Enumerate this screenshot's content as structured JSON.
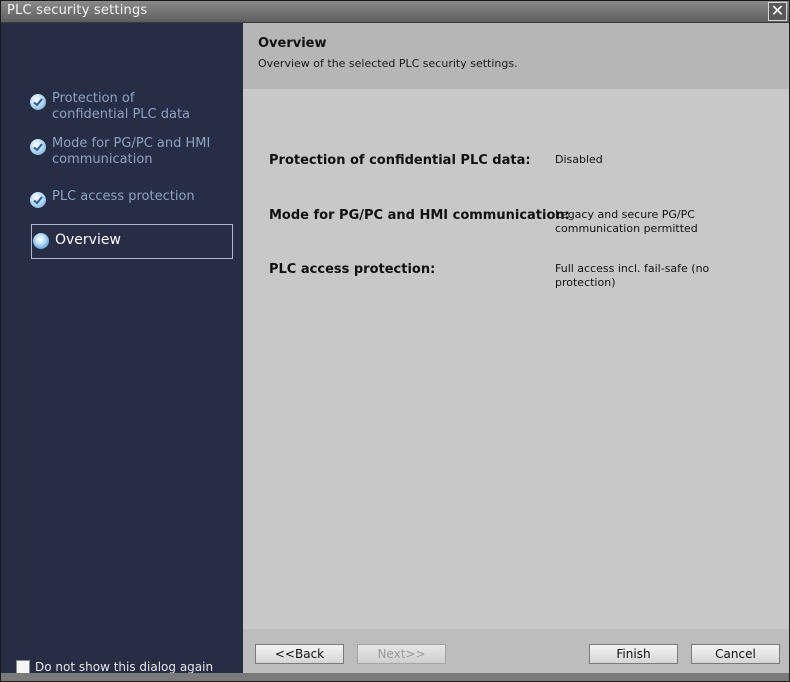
{
  "window": {
    "title": "PLC security settings"
  },
  "sidebar": {
    "steps": [
      {
        "label_line1": "Protection of",
        "label_line2": "confidential PLC data",
        "state": "done"
      },
      {
        "label_line1": "Mode for PG/PC and HMI",
        "label_line2": "communication",
        "state": "done"
      },
      {
        "label": "PLC access protection",
        "state": "done"
      },
      {
        "label": "Overview",
        "state": "active"
      }
    ],
    "dont_show_label": "Do not show this dialog again"
  },
  "header": {
    "title": "Overview",
    "subtitle": "Overview of the selected PLC security settings."
  },
  "summary": [
    {
      "key": "Protection of confidential PLC data:",
      "value_line1": "Disabled",
      "value_line2": ""
    },
    {
      "key": "Mode for PG/PC and HMI communication:",
      "value_line1": "Legacy and secure PG/PC",
      "value_line2": "communication permitted"
    },
    {
      "key": "PLC access protection:",
      "value_line1": "Full access incl. fail-safe (no",
      "value_line2": "protection)"
    }
  ],
  "buttons": {
    "back": "<<Back",
    "next": "Next>>",
    "finish": "Finish",
    "cancel": "Cancel"
  },
  "icons": {
    "close": "close-icon",
    "check": "check-icon",
    "current_step": "current-step-icon"
  }
}
